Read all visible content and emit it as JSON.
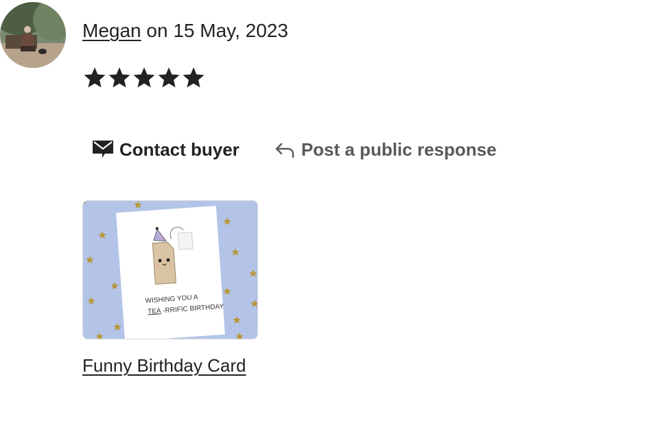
{
  "review": {
    "reviewer_name": "Megan",
    "date_text": "on 15 May, 2023",
    "rating": 5,
    "rating_max": 5
  },
  "actions": {
    "contact_label": "Contact buyer",
    "contact_icon": "mail-icon",
    "respond_label": "Post a public response",
    "respond_icon": "reply-arrow-icon"
  },
  "listing": {
    "title": "Funny Birthday Card",
    "card_line1": "WISHING YOU A",
    "card_line2_underlined": "TEA",
    "card_line2_rest": "-RRIFIC BIRTHDAY"
  },
  "colors": {
    "text": "#222222",
    "muted": "#595959",
    "thumb_bg": "#b3c4e8",
    "star_gold": "#b8963a"
  }
}
